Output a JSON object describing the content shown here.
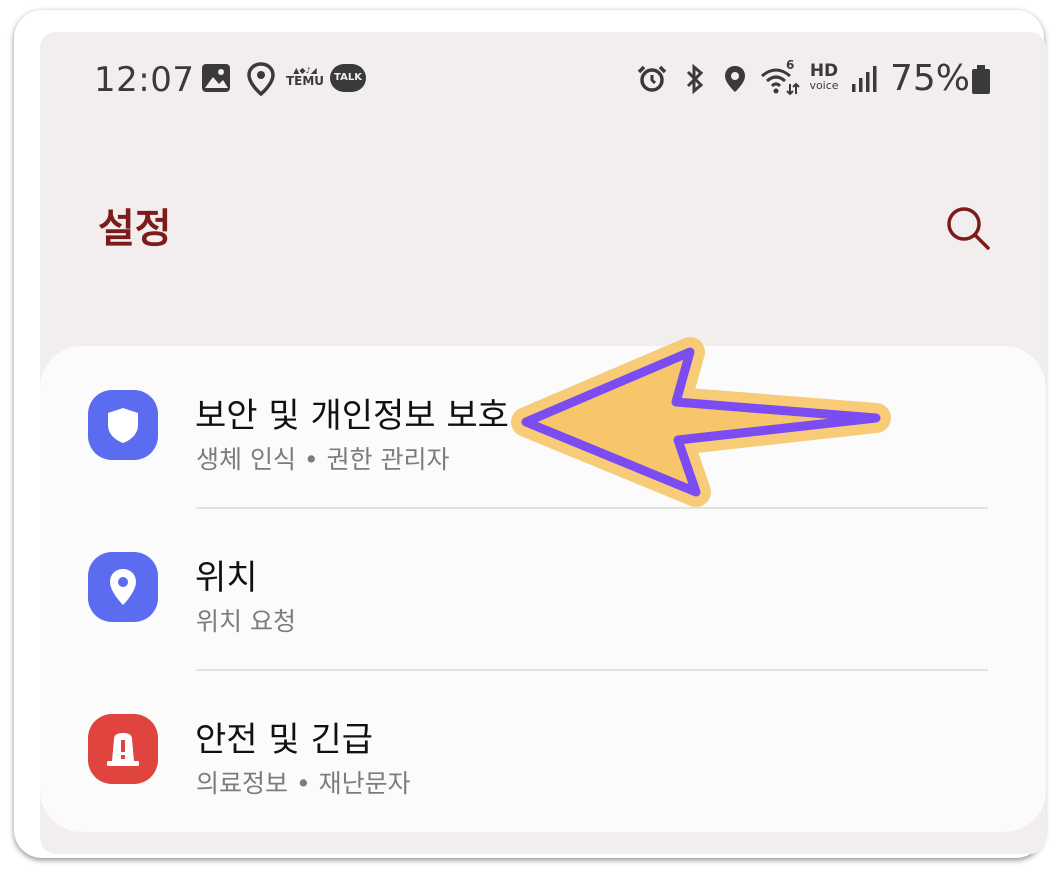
{
  "status_bar": {
    "time": "12:07",
    "temu_label": "TEMU",
    "talk_label": "TALK",
    "hd_label": "HD",
    "voice_label": "voice",
    "wifi_label": "6",
    "battery": "75%"
  },
  "header": {
    "title": "설정"
  },
  "settings": [
    {
      "title": "보안 및 개인정보 보호",
      "subtitle": "생체 인식  •  권한 관리자",
      "icon": "shield-icon",
      "color": "#5b6cf0"
    },
    {
      "title": "위치",
      "subtitle": "위치 요청",
      "icon": "location-pin-icon",
      "color": "#5b6cf0"
    },
    {
      "title": "안전 및 긴급",
      "subtitle": "의료정보  •  재난문자",
      "icon": "emergency-siren-icon",
      "color": "#e0443e"
    }
  ],
  "colors": {
    "title": "#7d1b1b",
    "arrow_fill": "#f7c56a",
    "arrow_stroke": "#7a4cf2"
  }
}
